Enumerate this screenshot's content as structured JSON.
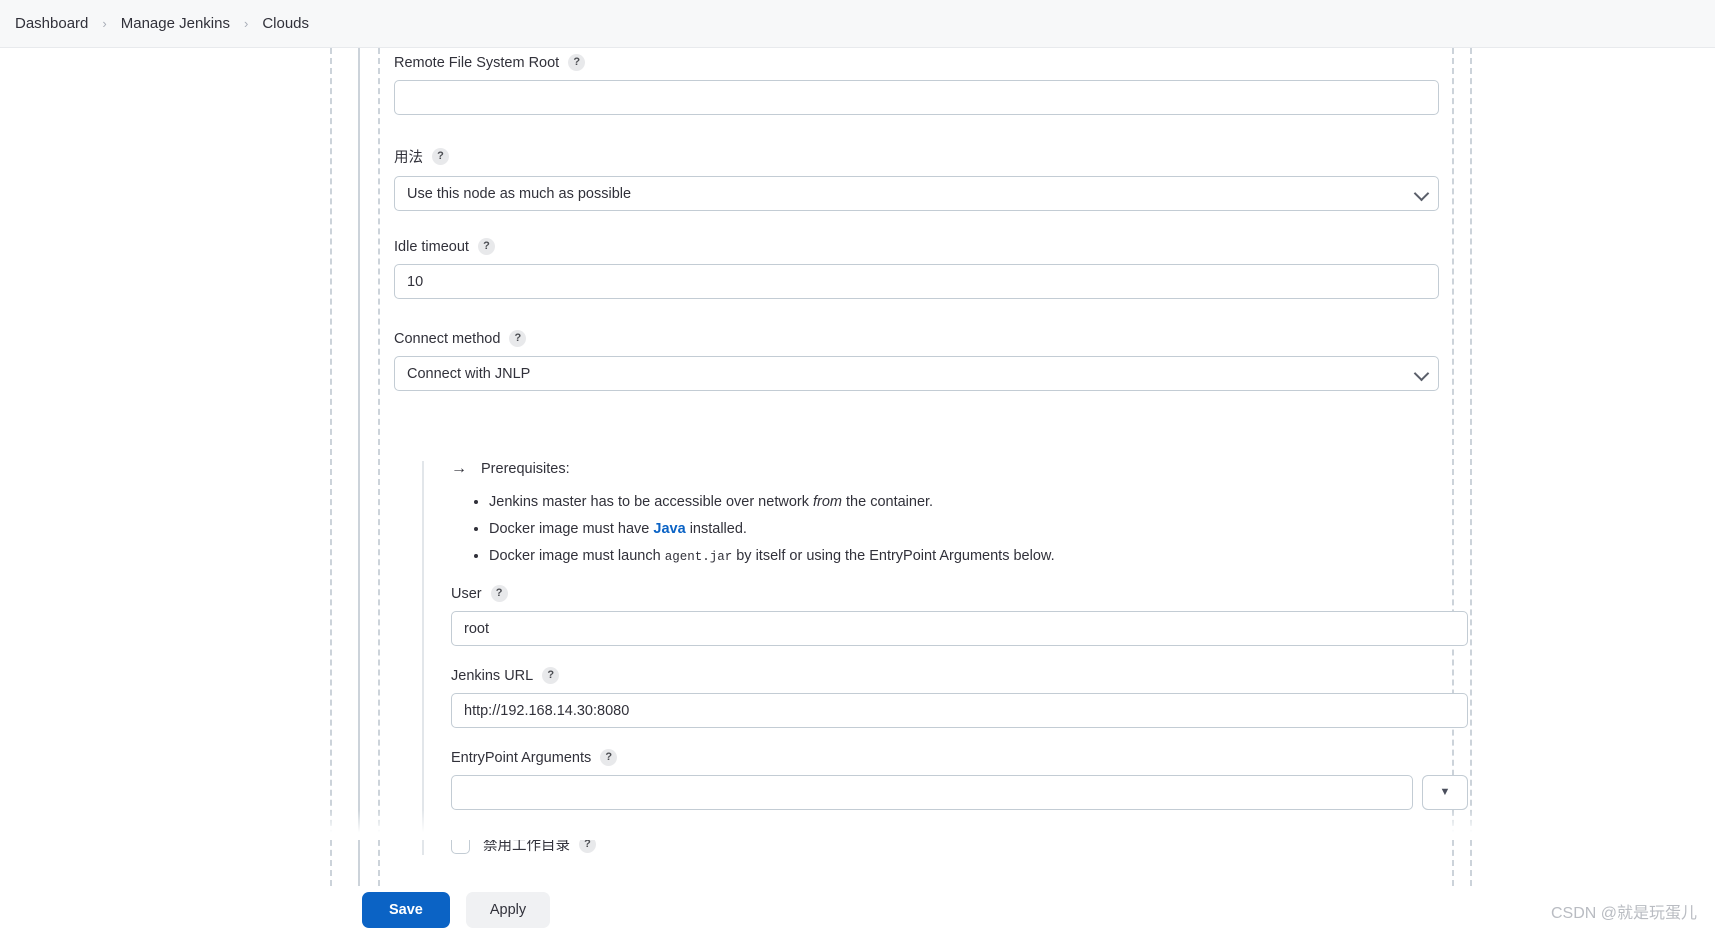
{
  "breadcrumb": {
    "items": [
      {
        "label": "Dashboard"
      },
      {
        "label": "Manage Jenkins"
      },
      {
        "label": "Clouds"
      }
    ],
    "separator": "›"
  },
  "icons": {
    "help": "?",
    "arrow_right": "→",
    "dropdown_triangle": "▼"
  },
  "form": {
    "remote_fs_root": {
      "label": "Remote File System Root",
      "value": "",
      "placeholder": ""
    },
    "usage": {
      "label": "用法",
      "value": "Use this node as much as possible"
    },
    "idle_timeout": {
      "label": "Idle timeout",
      "value": "10"
    },
    "connect_method": {
      "label": "Connect method",
      "value": "Connect with JNLP"
    }
  },
  "prerequisites": {
    "heading": "Prerequisites:",
    "items": [
      {
        "pre": "Jenkins master has to be accessible over network ",
        "em": "from",
        "post": " the container."
      },
      {
        "pre": "Docker image must have ",
        "link": "Java",
        "post": " installed."
      },
      {
        "pre": "Docker image must launch ",
        "code": "agent.jar",
        "post": " by itself or using the EntryPoint Arguments below."
      }
    ]
  },
  "jnlp": {
    "user": {
      "label": "User",
      "value": "root"
    },
    "jenkins_url": {
      "label": "Jenkins URL",
      "value": "http://192.168.14.30:8080"
    },
    "entrypoint_arguments": {
      "label": "EntryPoint Arguments",
      "value": "",
      "placeholder": ""
    },
    "disable_workdir": {
      "label": "禁用工作目录",
      "checked": false
    }
  },
  "actions": {
    "save_label": "Save",
    "apply_label": "Apply"
  },
  "watermark": {
    "text": "CSDN @就是玩蛋儿"
  },
  "colors": {
    "accent": "#0b63c5",
    "link": "#0b63c5",
    "border": "#c3ccd4",
    "rule": "#ccd3da",
    "breadcrumb_bg": "#f7f8f9"
  }
}
